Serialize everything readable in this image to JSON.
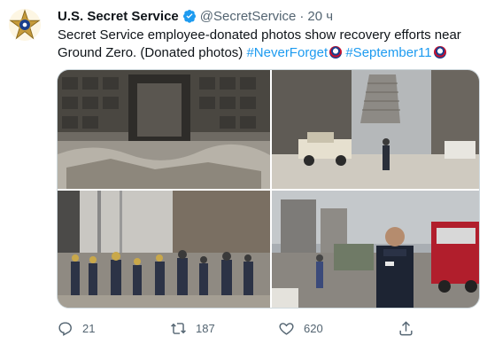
{
  "author": {
    "display_name": "U.S. Secret Service",
    "handle": "@SecretService",
    "separator": "·",
    "time": "20 ч",
    "avatar_icon": "secret-service-star-badge",
    "verified_icon": "verified-badge-icon"
  },
  "tweet": {
    "text_prefix": "Secret Service employee-donated photos show recovery efforts near Ground Zero. (Donated photos) ",
    "hashtag_1": "#NeverForget",
    "hashtag_2": "#September11",
    "emoji_icon": "usa-ribbon-emoji"
  },
  "media": {
    "photos": [
      {
        "name": "collapsed-building-facade"
      },
      {
        "name": "recovery-vehicles-and-tower-ruins"
      },
      {
        "name": "firefighters-crowd-at-site"
      },
      {
        "name": "police-officer-near-fire-truck"
      }
    ]
  },
  "actions": {
    "replies": "21",
    "retweets": "187",
    "likes": "620",
    "reply_icon": "reply-icon",
    "retweet_icon": "retweet-icon",
    "like_icon": "heart-icon",
    "share_icon": "share-icon"
  },
  "colors": {
    "accent": "#1d9bf0",
    "text": "#0f1419",
    "muted": "#536471",
    "badge_gold": "#c59a3a"
  }
}
